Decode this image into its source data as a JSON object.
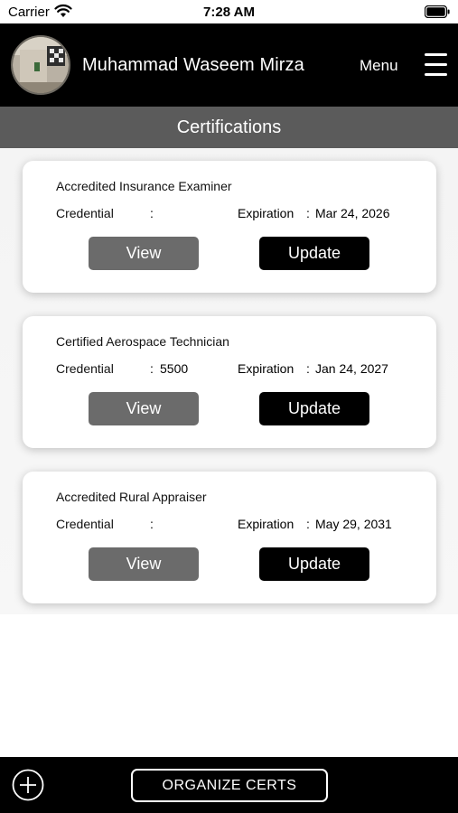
{
  "status_bar": {
    "carrier": "Carrier",
    "time": "7:28 AM"
  },
  "header": {
    "user_name": "Muhammad Waseem Mirza",
    "menu_label": "Menu"
  },
  "page_title": "Certifications",
  "labels": {
    "credential": "Credential",
    "expiration": "Expiration",
    "colon": ":"
  },
  "certifications": [
    {
      "title": "Accredited Insurance Examiner",
      "credential": "",
      "expiration": "Mar 24, 2026",
      "view_label": "View",
      "update_label": "Update"
    },
    {
      "title": "Certified Aerospace Technician",
      "credential": "5500",
      "expiration": "Jan 24, 2027",
      "view_label": "View",
      "update_label": "Update"
    },
    {
      "title": "Accredited Rural Appraiser",
      "credential": "",
      "expiration": "May 29, 2031",
      "view_label": "View",
      "update_label": "Update"
    }
  ],
  "bottom_bar": {
    "organize_label": "ORGANIZE CERTS"
  },
  "colors": {
    "header_bg": "#000000",
    "title_bar_bg": "#5b5b5b",
    "view_button": "#6b6b6b",
    "update_button": "#000000"
  }
}
